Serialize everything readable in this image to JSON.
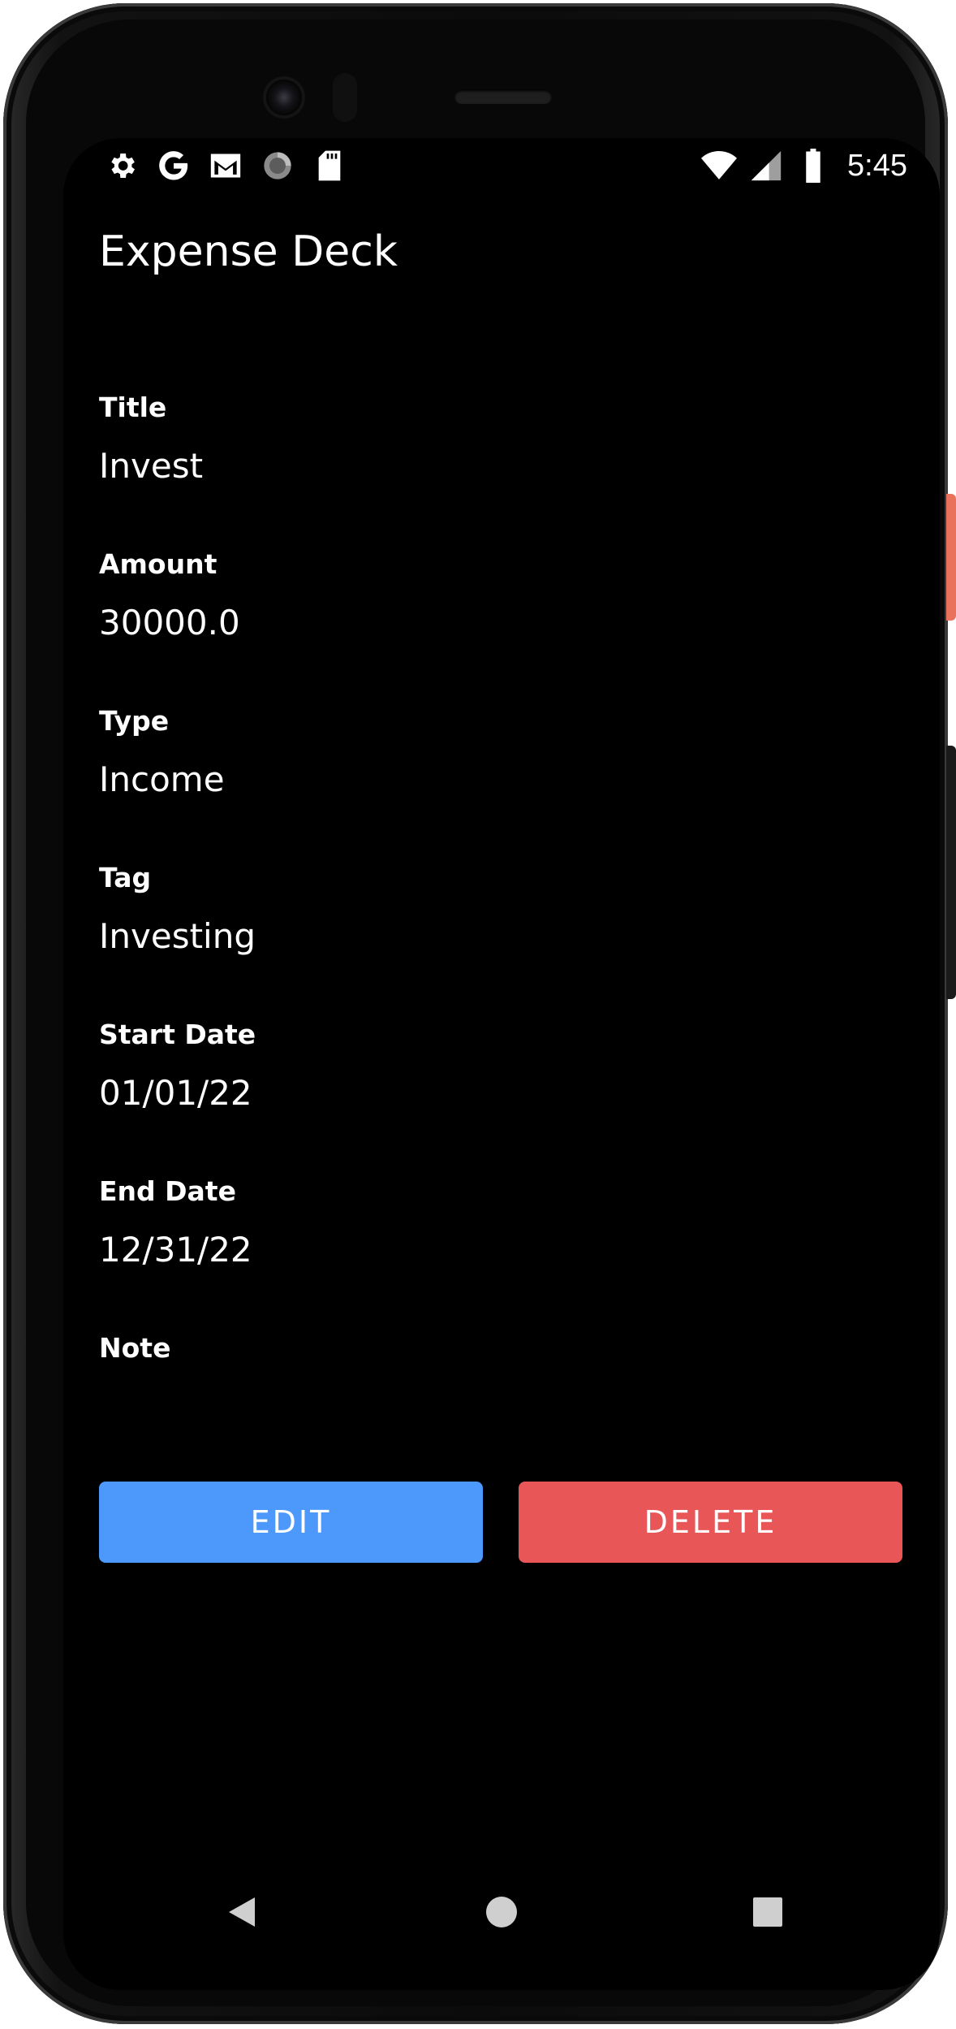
{
  "status_bar": {
    "time": "5:45",
    "left_icons": [
      "settings-icon",
      "google-icon",
      "gmail-icon",
      "sync-progress-icon",
      "sd-card-icon"
    ],
    "right_icons": [
      "wifi-icon",
      "cellular-signal-icon",
      "battery-icon"
    ]
  },
  "app": {
    "title": "Expense Deck"
  },
  "fields": [
    {
      "label": "Title",
      "value": "Invest"
    },
    {
      "label": "Amount",
      "value": "30000.0"
    },
    {
      "label": "Type",
      "value": "Income"
    },
    {
      "label": "Tag",
      "value": "Investing"
    },
    {
      "label": "Start Date",
      "value": "01/01/22"
    },
    {
      "label": "End Date",
      "value": "12/31/22"
    },
    {
      "label": "Note",
      "value": ""
    }
  ],
  "actions": {
    "edit_label": "EDIT",
    "delete_label": "DELETE"
  },
  "colors": {
    "background": "#000000",
    "edit_button": "#4c98fb",
    "delete_button": "#e95657",
    "text": "#ffffff"
  },
  "nav_bar": {
    "icons": [
      "back-icon",
      "home-icon",
      "recents-icon"
    ]
  }
}
